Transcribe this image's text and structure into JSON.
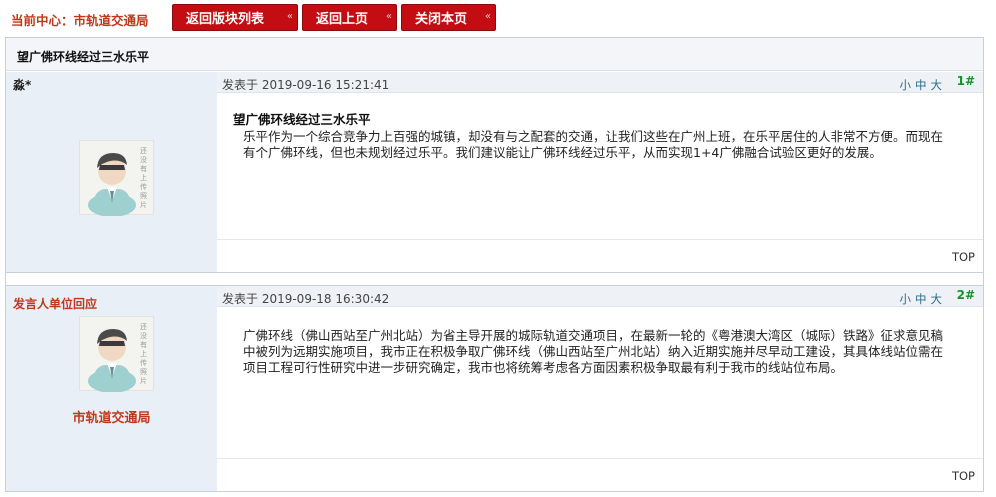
{
  "topbar": {
    "center_label": "当前中心：",
    "center_name": "市轨道交通局",
    "buttons": [
      {
        "label": "返回版块列表"
      },
      {
        "label": "返回上页"
      },
      {
        "label": "关闭本页"
      }
    ],
    "chevron": "«"
  },
  "thread": {
    "title": "望广佛环线经过三水乐平"
  },
  "posts": [
    {
      "author": "淼*",
      "date": "发表于 2019-09-16 15:21:41",
      "font_controls": "小中大",
      "floor": "1#",
      "subject": "望广佛环线经过三水乐平",
      "body": "乐平作为一个综合竞争力上百强的城镇，却没有与之配套的交通，让我们这些在广州上班，在乐平居住的人非常不方便。而现在有个广佛环线，但也未规划经过乐平。我们建议能让广佛环线经过乐平，从而实现1+4广佛融合试验区更好的发展。",
      "avatar_caption": "还没有上传照片",
      "top_link": "TOP"
    },
    {
      "author": "发言人单位回应",
      "date": "发表于 2019-09-18 16:30:42",
      "font_controls": "小中大",
      "floor": "2#",
      "org_name": "市轨道交通局",
      "body": "广佛环线（佛山西站至广州北站）为省主导开展的城际轨道交通项目，在最新一轮的《粤港澳大湾区（城际）铁路》征求意见稿中被列为远期实施项目，我市正在积极争取广佛环线（佛山西站至广州北站）纳入近期实施并尽早动工建设，其具体线站位需在项目工程可行性研究中进一步研究确定，我市也将统筹考虑各方面因素积极争取最有利于我市的线站位布局。",
      "avatar_caption": "还没有上传照片",
      "top_link": "TOP"
    }
  ],
  "colors": {
    "button_bg": "#c30d12",
    "accent_red": "#c0381b",
    "floor_green": "#1f8d2a",
    "sidebar_bg": "#e9eff7"
  }
}
